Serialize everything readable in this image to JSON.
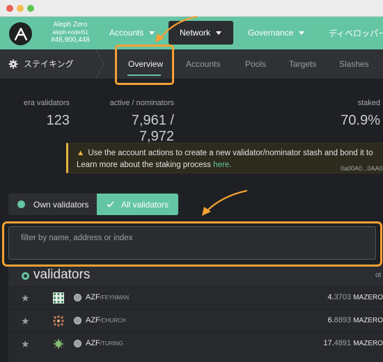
{
  "window": {
    "controls": [
      "close",
      "minimize",
      "maximize"
    ]
  },
  "chain": {
    "name": "Aleph Zero",
    "node": "aleph-node/61",
    "block": "#46,900,448"
  },
  "nav": {
    "accounts": "Accounts",
    "network": "Network",
    "governance": "Governance",
    "developer": "ディベロッパー"
  },
  "subnav": {
    "section": "ステイキング",
    "tabs": [
      "Overview",
      "Accounts",
      "Pools",
      "Targets",
      "Slashes"
    ]
  },
  "stats": {
    "era_label": "era validators",
    "era_value": "123",
    "active_label": "active / nominators",
    "active_value": "7,961 / 7,972",
    "staked_label": "staked",
    "staked_value": "70.9%"
  },
  "notice": {
    "line1": "Use the account actions to create a new validator/nominator stash and bond it to",
    "line2": "Learn more about the staking process ",
    "link": "here.",
    "address": "0a00A0...0AA0"
  },
  "toggle": {
    "own": "Own validators",
    "all": "All validators"
  },
  "filter": {
    "placeholder": "filter by name, address or index"
  },
  "validators": {
    "title": "validators",
    "col_other": "ot",
    "rows": [
      {
        "prefix": "AZF",
        "suffix": "/FEYNMAN",
        "stake_int": "4.",
        "stake_dec": "3703",
        "unit": "MAZERO"
      },
      {
        "prefix": "AZF",
        "suffix": "/CHURCH",
        "stake_int": "6.",
        "stake_dec": "8893",
        "unit": "MAZERO"
      },
      {
        "prefix": "AZF",
        "suffix": "/TURING",
        "stake_int": "17.",
        "stake_dec": "4891",
        "unit": "MAZERO"
      }
    ]
  },
  "colors": {
    "accent": "#64c5a3",
    "highlight": "#f5a133",
    "warning": "#e3b343",
    "background": "#1f2023"
  }
}
